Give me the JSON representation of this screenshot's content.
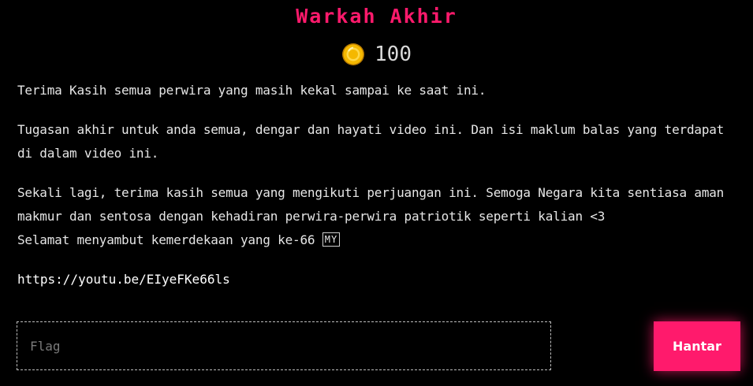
{
  "page": {
    "title": "Warkah Akhir"
  },
  "points": {
    "icon": "coin-icon",
    "value": "100"
  },
  "message": {
    "paragraph_1": "Terima Kasih semua perwira yang masih kekal sampai ke saat ini.",
    "paragraph_2": "Tugasan akhir untuk anda semua, dengar dan hayati video ini. Dan isi maklum balas yang terdapat di dalam video ini.",
    "paragraph_3_line_1": "Sekali lagi, terima kasih semua yang mengikuti perjuangan ini. Semoga Negara kita sentiasa aman makmur dan sentosa dengan kehadiran perwira-perwira patriotik seperti kalian <3",
    "paragraph_3_line_2": "Selamat menyambut kemerdekaan yang ke-66",
    "flag_emoji": "MY"
  },
  "link": {
    "text": "https://youtu.be/EIyeFKe66ls"
  },
  "form": {
    "flag_placeholder": "Flag",
    "flag_value": "",
    "submit_label": "Hantar"
  },
  "colors": {
    "accent": "#ff1a6c",
    "background": "#000000",
    "text": "#e6e6e6",
    "coin": "#f5b800"
  }
}
